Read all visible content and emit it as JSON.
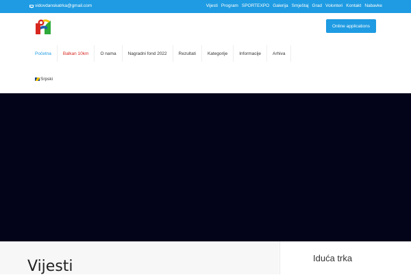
{
  "topbar": {
    "email": "vidovdanskatrka@gmail.com",
    "links": [
      "Vijesti",
      "Program",
      "SPORTEXPO",
      "Galerija",
      "Smještaj",
      "Grad",
      "Volonteri",
      "Kontakt",
      "Nabavke"
    ]
  },
  "header": {
    "logo_icon": "site-logo",
    "cta_label": "Online applications"
  },
  "nav": {
    "items": [
      "Početna",
      "Balkan 10km",
      "O nama",
      "Nagradni fond 2022",
      "Rezultati",
      "Kategorije",
      "Informacije",
      "Arhiva"
    ]
  },
  "language": {
    "label": "Srpski",
    "flag_icon": "flag-icon"
  },
  "hero": {
    "color": "#03041a"
  },
  "content": {
    "news_heading": "Vijesti",
    "sidebar_heading": "Iduća trka"
  },
  "colors": {
    "accent": "#1e9be2",
    "highlight": "#d7261e"
  }
}
